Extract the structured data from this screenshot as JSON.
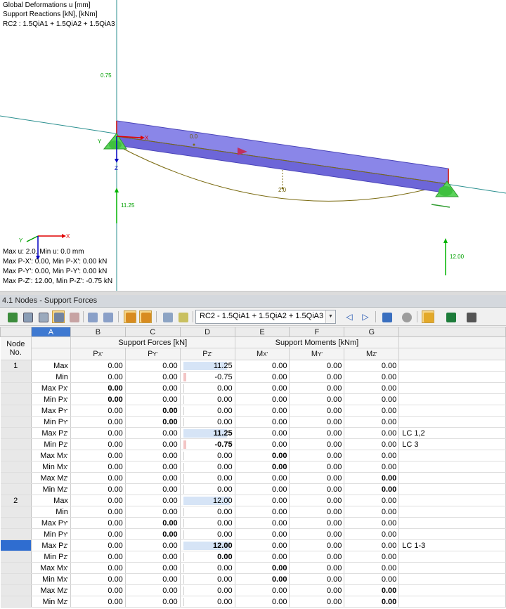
{
  "viewport": {
    "info_lines": [
      "Global Deformations u [mm]",
      "Support Reactions [kN], [kNm]",
      "RC2 : 1.5QiA1 + 1.5QiA2 + 1.5QiA3"
    ],
    "labels": {
      "reaction_top": "0.75",
      "reaction_node1": "11.25",
      "reaction_node2": "12.00",
      "deflection_mid": "2.0",
      "deflection_start": "0.0",
      "axis_x": "X",
      "axis_y": "Y",
      "axis_z": "Z",
      "triad_x": "X",
      "triad_y": "Y"
    },
    "summary_lines": [
      "Max u: 2.0, Min u: 0.0 mm",
      "Max P-X': 0.00, Min P-X': 0.00 kN",
      "Max P-Y': 0.00, Min P-Y': 0.00 kN",
      "Max P-Z': 12.00, Min P-Z': -0.75 kN"
    ],
    "colors": {
      "beam": "#8a86e8",
      "support": "#5bd35b",
      "reaction": "#00b400",
      "axis_x": "#e00000",
      "axis_z": "#0000c0",
      "deflection": "#7a6a10"
    }
  },
  "panel": {
    "title": "4.1 Nodes - Support Forces"
  },
  "toolbar": {
    "loadcase_select": "RC2 - 1.5QiA1 + 1.5QiA2 + 1.5QiA3",
    "prev_label": "◁",
    "next_label": "▷",
    "icons": [
      "excel-icon-left",
      "table-icon-1",
      "table-icon-2",
      "table-icon-3",
      "table-icon-4",
      "nav-prev-icon",
      "nav-next-icon",
      "filter-icon-1",
      "filter-icon-2",
      "grid-icon",
      "edit-icon",
      "funnel-icon",
      "search-icon",
      "color-bar-icon",
      "excel-icon",
      "calculator-icon"
    ]
  },
  "table": {
    "col_letters": [
      "A",
      "B",
      "C",
      "D",
      "E",
      "F",
      "G"
    ],
    "node_header": [
      "Node",
      "No."
    ],
    "group_forces": "Support Forces [kN]",
    "group_moments": "Support Moments [kNm]",
    "sub_headers": [
      {
        "main": "P",
        "sub": "X'"
      },
      {
        "main": "P",
        "sub": "Y'"
      },
      {
        "main": "P",
        "sub": "Z'"
      },
      {
        "main": "M",
        "sub": "X'"
      },
      {
        "main": "M",
        "sub": "Y'"
      },
      {
        "main": "M",
        "sub": "Z'"
      }
    ],
    "rows": [
      {
        "node": "1",
        "type": "Max",
        "sub": "",
        "vals": [
          "0.00",
          "0.00",
          "11.25",
          "0.00",
          "0.00",
          "0.00"
        ],
        "bold": [],
        "lc": "",
        "dbar": "pos",
        "dfrac": 0.94
      },
      {
        "node": "",
        "type": "Min",
        "sub": "",
        "vals": [
          "0.00",
          "0.00",
          "-0.75",
          "0.00",
          "0.00",
          "0.00"
        ],
        "bold": [],
        "lc": "",
        "dbar": "neg",
        "dfrac": 0
      },
      {
        "node": "",
        "type": "Max P",
        "sub": "X'",
        "vals": [
          "0.00",
          "0.00",
          "0.00",
          "0.00",
          "0.00",
          "0.00"
        ],
        "bold": [
          0
        ],
        "lc": "",
        "dbar": "zero",
        "dfrac": 0
      },
      {
        "node": "",
        "type": "Min P",
        "sub": "X'",
        "vals": [
          "0.00",
          "0.00",
          "0.00",
          "0.00",
          "0.00",
          "0.00"
        ],
        "bold": [
          0
        ],
        "lc": "",
        "dbar": "zero",
        "dfrac": 0
      },
      {
        "node": "",
        "type": "Max P",
        "sub": "Y'",
        "vals": [
          "0.00",
          "0.00",
          "0.00",
          "0.00",
          "0.00",
          "0.00"
        ],
        "bold": [
          1
        ],
        "lc": "",
        "dbar": "zero",
        "dfrac": 0
      },
      {
        "node": "",
        "type": "Min P",
        "sub": "Y'",
        "vals": [
          "0.00",
          "0.00",
          "0.00",
          "0.00",
          "0.00",
          "0.00"
        ],
        "bold": [
          1
        ],
        "lc": "",
        "dbar": "zero",
        "dfrac": 0
      },
      {
        "node": "",
        "type": "Max P",
        "sub": "Z'",
        "vals": [
          "0.00",
          "0.00",
          "11.25",
          "0.00",
          "0.00",
          "0.00"
        ],
        "bold": [
          2
        ],
        "lc": "LC 1,2",
        "dbar": "pos",
        "dfrac": 0.94
      },
      {
        "node": "",
        "type": "Min P",
        "sub": "Z'",
        "vals": [
          "0.00",
          "0.00",
          "-0.75",
          "0.00",
          "0.00",
          "0.00"
        ],
        "bold": [
          2
        ],
        "lc": "LC 3",
        "dbar": "neg",
        "dfrac": 0
      },
      {
        "node": "",
        "type": "Max M",
        "sub": "X'",
        "vals": [
          "0.00",
          "0.00",
          "0.00",
          "0.00",
          "0.00",
          "0.00"
        ],
        "bold": [
          3
        ],
        "lc": "",
        "dbar": "zero",
        "dfrac": 0
      },
      {
        "node": "",
        "type": "Min M",
        "sub": "X'",
        "vals": [
          "0.00",
          "0.00",
          "0.00",
          "0.00",
          "0.00",
          "0.00"
        ],
        "bold": [
          3
        ],
        "lc": "",
        "dbar": "zero",
        "dfrac": 0
      },
      {
        "node": "",
        "type": "Max M",
        "sub": "Z'",
        "vals": [
          "0.00",
          "0.00",
          "0.00",
          "0.00",
          "0.00",
          "0.00"
        ],
        "bold": [
          5
        ],
        "lc": "",
        "dbar": "zero",
        "dfrac": 0
      },
      {
        "node": "",
        "type": "Min M",
        "sub": "Z'",
        "vals": [
          "0.00",
          "0.00",
          "0.00",
          "0.00",
          "0.00",
          "0.00"
        ],
        "bold": [
          5
        ],
        "lc": "",
        "dbar": "zero",
        "dfrac": 0
      },
      {
        "node": "2",
        "type": "Max",
        "sub": "",
        "vals": [
          "0.00",
          "0.00",
          "12.00",
          "0.00",
          "0.00",
          "0.00"
        ],
        "bold": [],
        "lc": "",
        "dbar": "pos",
        "dfrac": 1.0
      },
      {
        "node": "",
        "type": "Min",
        "sub": "",
        "vals": [
          "0.00",
          "0.00",
          "0.00",
          "0.00",
          "0.00",
          "0.00"
        ],
        "bold": [],
        "lc": "",
        "dbar": "zero",
        "dfrac": 0
      },
      {
        "node": "",
        "type": "Max P",
        "sub": "Y'",
        "vals": [
          "0.00",
          "0.00",
          "0.00",
          "0.00",
          "0.00",
          "0.00"
        ],
        "bold": [
          1
        ],
        "lc": "",
        "dbar": "zero",
        "dfrac": 0
      },
      {
        "node": "",
        "type": "Min P",
        "sub": "Y'",
        "vals": [
          "0.00",
          "0.00",
          "0.00",
          "0.00",
          "0.00",
          "0.00"
        ],
        "bold": [
          1
        ],
        "lc": "",
        "dbar": "zero",
        "dfrac": 0
      },
      {
        "node": "",
        "type": "Max P",
        "sub": "Z'",
        "vals": [
          "0.00",
          "0.00",
          "12.00",
          "0.00",
          "0.00",
          "0.00"
        ],
        "bold": [
          2
        ],
        "lc": "LC 1-3",
        "dbar": "pos",
        "dfrac": 1.0,
        "selected": true
      },
      {
        "node": "",
        "type": "Min P",
        "sub": "Z'",
        "vals": [
          "0.00",
          "0.00",
          "0.00",
          "0.00",
          "0.00",
          "0.00"
        ],
        "bold": [
          2
        ],
        "lc": "",
        "dbar": "zero",
        "dfrac": 0
      },
      {
        "node": "",
        "type": "Max M",
        "sub": "X'",
        "vals": [
          "0.00",
          "0.00",
          "0.00",
          "0.00",
          "0.00",
          "0.00"
        ],
        "bold": [
          3
        ],
        "lc": "",
        "dbar": "zero",
        "dfrac": 0
      },
      {
        "node": "",
        "type": "Min M",
        "sub": "X'",
        "vals": [
          "0.00",
          "0.00",
          "0.00",
          "0.00",
          "0.00",
          "0.00"
        ],
        "bold": [
          3
        ],
        "lc": "",
        "dbar": "zero",
        "dfrac": 0
      },
      {
        "node": "",
        "type": "Max M",
        "sub": "Z'",
        "vals": [
          "0.00",
          "0.00",
          "0.00",
          "0.00",
          "0.00",
          "0.00"
        ],
        "bold": [
          5
        ],
        "lc": "",
        "dbar": "zero",
        "dfrac": 0
      },
      {
        "node": "",
        "type": "Min M",
        "sub": "Z'",
        "vals": [
          "0.00",
          "0.00",
          "0.00",
          "0.00",
          "0.00",
          "0.00"
        ],
        "bold": [
          5
        ],
        "lc": "",
        "dbar": "zero",
        "dfrac": 0
      }
    ]
  }
}
